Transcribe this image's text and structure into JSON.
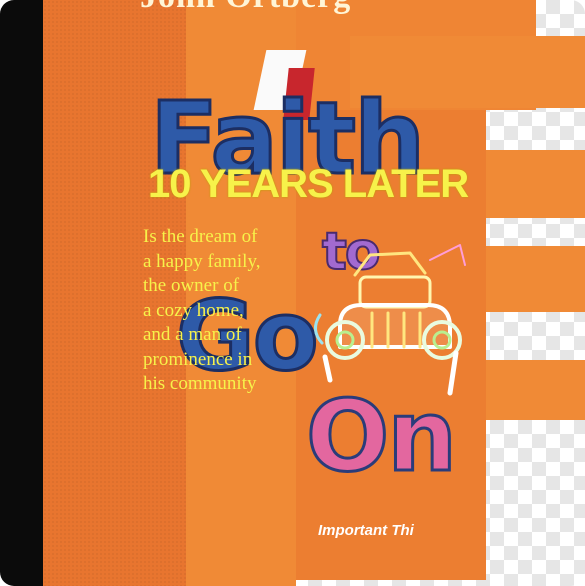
{
  "cover": {
    "author_partial": "John Ortberg",
    "title_fragments": [
      "Faith",
      "to",
      "Go",
      "On"
    ],
    "subtitle_partial": "Important Thi",
    "overlay_heading": "10 YEARS LATER",
    "overlay_lines": [
      "Is the dream of",
      "a happy family,",
      "the owner of",
      "a cozy home,",
      "and a man of",
      "prominence in",
      "his community"
    ]
  },
  "colors": {
    "spine": "#0b0b0b",
    "cover_orange": "#e8752f",
    "strip_orange": "#f08a36",
    "title_blue": "#2e5aa8",
    "overlay_yellow": "#f7f24a"
  },
  "icons": [
    "vintage-car-icon"
  ]
}
